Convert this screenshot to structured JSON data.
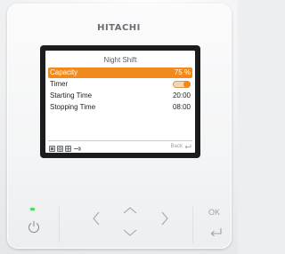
{
  "device": {
    "brand": "HITACHI"
  },
  "screen": {
    "title": "Night Shift",
    "rows": [
      {
        "label": "Capacity",
        "value": "75 %",
        "selected": true
      },
      {
        "label": "Timer",
        "value": "",
        "toggle_on": true
      },
      {
        "label": "Starting Time",
        "value": "20:00"
      },
      {
        "label": "Stopping Time",
        "value": "08:00"
      }
    ],
    "footer": {
      "icons": [
        "mode-icon",
        "fan-icon",
        "grid-icon",
        "wrench-icon"
      ],
      "back_label": "Back"
    }
  },
  "buttons": {
    "power": "power-icon",
    "left": "chevron-left-icon",
    "up": "chevron-up-icon",
    "down": "chevron-down-icon",
    "right": "chevron-right-icon",
    "ok_label": "OK",
    "return": "return-icon"
  },
  "colors": {
    "accent": "#f18a1c",
    "led": "#52d26a",
    "screen_bezel": "#1c1c1e"
  }
}
